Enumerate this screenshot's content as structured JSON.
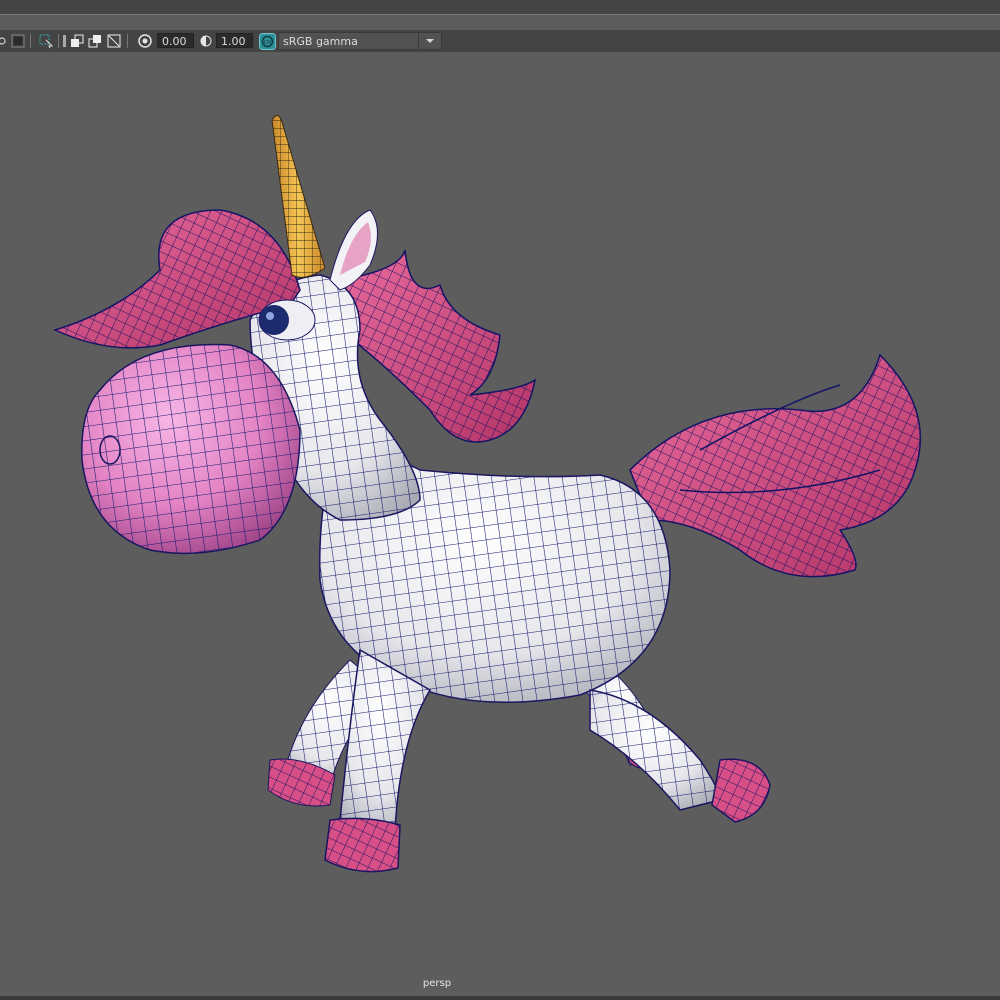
{
  "toolbar": {
    "exposure_value": "0.00",
    "gamma_value": "1.00",
    "color_space": "sRGB gamma"
  },
  "viewport": {
    "camera_label": "persp"
  },
  "icons": [
    "film-gate-icon",
    "resolution-gate-icon",
    "grid-icon",
    "isolate-icon",
    "xray-icon",
    "wireframe-icon",
    "exposure-icon",
    "gamma-icon",
    "color-management-icon",
    "chevron-down-icon"
  ],
  "colors": {
    "viewport_bg": "#5d5d5d",
    "panel_bg": "#444444",
    "body": "#e9e9ee",
    "wire": "#161b6e",
    "mane": "#d74f86",
    "snout": "#e88ac8",
    "horn": "#e8b13f",
    "accent": "#3a9fa6"
  }
}
